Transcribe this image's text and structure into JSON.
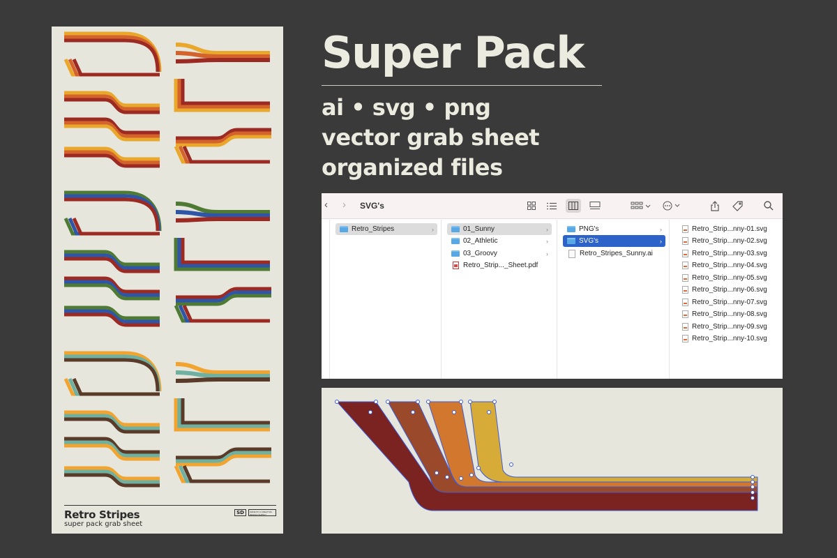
{
  "headline": {
    "title": "Super Pack",
    "features": [
      "ai • svg • png",
      "vector grab sheet",
      "organized files"
    ]
  },
  "poster": {
    "title": "Retro Stripes",
    "subtitle": "super pack grab sheet",
    "badge_logo": "SD",
    "badge_text": "MADE BY A CREATIVE · DESIGN SUPPLY",
    "palettes": {
      "sunny": [
        "#e9a72c",
        "#d3622b",
        "#9b2a22"
      ],
      "athletic": [
        "#4f7a35",
        "#2e55a6",
        "#9b2a22"
      ],
      "groovy": [
        "#f2a431",
        "#6fb0a0",
        "#5a3a28"
      ]
    }
  },
  "finder": {
    "title": "SVG's",
    "back_glyph": "‹",
    "forward_glyph": "›",
    "toolbar_icons": [
      "grid-view-icon",
      "list-view-icon",
      "column-view-icon",
      "gallery-view-icon",
      "group-icon",
      "more-icon",
      "share-icon",
      "tag-icon",
      "search-icon"
    ],
    "columns": [
      {
        "items": [
          {
            "name": "Retro_Stripes",
            "type": "folder",
            "state": "selected",
            "chevron": true
          }
        ]
      },
      {
        "items": [
          {
            "name": "01_Sunny",
            "type": "folder",
            "state": "selected",
            "chevron": true
          },
          {
            "name": "02_Athletic",
            "type": "folder",
            "state": "",
            "chevron": true
          },
          {
            "name": "03_Groovy",
            "type": "folder",
            "state": "",
            "chevron": true
          },
          {
            "name": "Retro_Strip..._Sheet.pdf",
            "type": "pdf",
            "state": "",
            "chevron": false
          }
        ]
      },
      {
        "items": [
          {
            "name": "PNG's",
            "type": "folder",
            "state": "",
            "chevron": true
          },
          {
            "name": "SVG's",
            "type": "folder",
            "state": "active",
            "chevron": true
          },
          {
            "name": "Retro_Stripes_Sunny.ai",
            "type": "ai",
            "state": "",
            "chevron": false
          }
        ]
      },
      {
        "items": [
          {
            "name": "Retro_Strip...nny-01.svg",
            "type": "svg"
          },
          {
            "name": "Retro_Strip...nny-02.svg",
            "type": "svg"
          },
          {
            "name": "Retro_Strip...nny-03.svg",
            "type": "svg"
          },
          {
            "name": "Retro_Strip...nny-04.svg",
            "type": "svg"
          },
          {
            "name": "Retro_Strip...nny-05.svg",
            "type": "svg"
          },
          {
            "name": "Retro_Strip...nny-06.svg",
            "type": "svg"
          },
          {
            "name": "Retro_Strip...nny-07.svg",
            "type": "svg"
          },
          {
            "name": "Retro_Strip...nny-08.svg",
            "type": "svg"
          },
          {
            "name": "Retro_Strip...nny-09.svg",
            "type": "svg"
          },
          {
            "name": "Retro_Strip...nny-10.svg",
            "type": "svg"
          }
        ]
      }
    ]
  },
  "editor": {
    "stripe_colors": [
      "#7a2320",
      "#9a4a2a",
      "#d1782e",
      "#d6ab37"
    ],
    "selection_color": "#3b5bd9"
  }
}
